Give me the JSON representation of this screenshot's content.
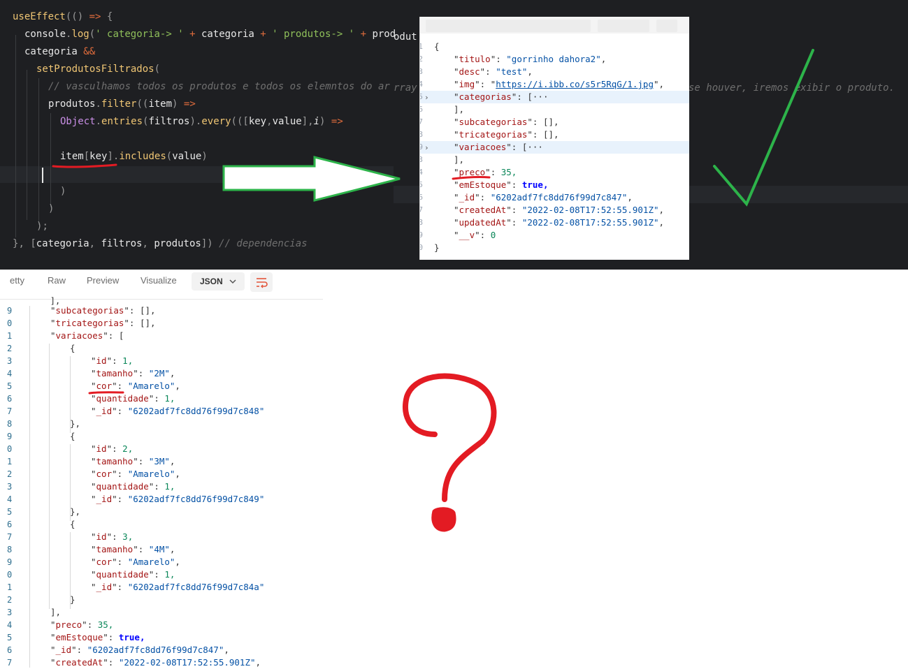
{
  "editor": {
    "lines": [
      {
        "id": "l1",
        "text": "useEffect(() => {"
      },
      {
        "id": "l2",
        "text": "console.log(' categoria-> ' + categoria + ' produtos-> ' + prod"
      },
      {
        "id": "l3",
        "text": "categoria &&"
      },
      {
        "id": "l4",
        "text": "setProdutosFiltrados("
      },
      {
        "id": "l5",
        "text": "// vasculhamos todos os produtos e todos os elemntos do ar"
      },
      {
        "id": "l6",
        "text": "produtos.filter((item) =>"
      },
      {
        "id": "l7",
        "text": "Object.entries(filtros).every(([key,value],i) =>"
      },
      {
        "id": "l8",
        "text": "item[key].includes(value)"
      },
      {
        "id": "l9",
        "text": ")"
      },
      {
        "id": "l10",
        "text": ")"
      },
      {
        "id": "l11",
        "text": ");"
      },
      {
        "id": "l12",
        "text": "}, [categoria, filtros, produtos]) // dependencias"
      }
    ],
    "overflow_comment_left": "rray",
    "overflow_comment_right": "se houver, iremos exibir o produto.",
    "overflow_top": "odut"
  },
  "popup_json": {
    "lines": [
      {
        "n": "1",
        "text": "{"
      },
      {
        "n": "2",
        "key": "titulo",
        "val": "gorrinho dahora2",
        "kind": "str"
      },
      {
        "n": "3",
        "key": "desc",
        "val": "test",
        "kind": "str"
      },
      {
        "n": "4",
        "key": "img",
        "val": "https://i.ibb.co/s5r5RqG/1.jpg",
        "kind": "link"
      },
      {
        "n": "5",
        "key": "categorias",
        "val": "[···",
        "kind": "collapsed"
      },
      {
        "n": "6",
        "text": "],"
      },
      {
        "n": "7",
        "key": "subcategorias",
        "val": "[],",
        "kind": "raw"
      },
      {
        "n": "8",
        "key": "tricategorias",
        "val": "[],",
        "kind": "raw"
      },
      {
        "n": "9",
        "key": "variacoes",
        "val": "[···",
        "kind": "collapsed"
      },
      {
        "n": "3",
        "text": "],"
      },
      {
        "n": "4",
        "key": "preco",
        "val": "35,",
        "kind": "num"
      },
      {
        "n": "5",
        "key": "emEstoque",
        "val": "true,",
        "kind": "bool"
      },
      {
        "n": "6",
        "key": "_id",
        "val": "6202adf7fc8dd76f99d7c847",
        "kind": "str"
      },
      {
        "n": "7",
        "key": "createdAt",
        "val": "2022-02-08T17:52:55.901Z",
        "kind": "str"
      },
      {
        "n": "8",
        "key": "updatedAt",
        "val": "2022-02-08T17:52:55.901Z",
        "kind": "str"
      },
      {
        "n": "9",
        "key": "__v",
        "val": "0",
        "kind": "numlast"
      },
      {
        "n": "0",
        "text": "}"
      }
    ]
  },
  "bottom_panel": {
    "tabs": [
      "etty",
      "Raw",
      "Preview",
      "Visualize"
    ],
    "format_select": "JSON",
    "json_lines": [
      {
        "n": "9",
        "indent": 1,
        "key": "subcategorias",
        "val": "[],",
        "kind": "raw"
      },
      {
        "n": "0",
        "indent": 1,
        "key": "tricategorias",
        "val": "[],",
        "kind": "raw"
      },
      {
        "n": "1",
        "indent": 1,
        "key": "variacoes",
        "val": "[",
        "kind": "raw"
      },
      {
        "n": "2",
        "indent": 2,
        "text": "{"
      },
      {
        "n": "3",
        "indent": 3,
        "key": "id",
        "val": "1,",
        "kind": "num"
      },
      {
        "n": "4",
        "indent": 3,
        "key": "tamanho",
        "val": "2M",
        "kind": "str"
      },
      {
        "n": "5",
        "indent": 3,
        "key": "cor",
        "val": "Amarelo",
        "kind": "str"
      },
      {
        "n": "6",
        "indent": 3,
        "key": "quantidade",
        "val": "1,",
        "kind": "num"
      },
      {
        "n": "7",
        "indent": 3,
        "key": "_id",
        "val": "6202adf7fc8dd76f99d7c848",
        "kind": "strlast"
      },
      {
        "n": "8",
        "indent": 2,
        "text": "},"
      },
      {
        "n": "9",
        "indent": 2,
        "text": "{"
      },
      {
        "n": "0",
        "indent": 3,
        "key": "id",
        "val": "2,",
        "kind": "num"
      },
      {
        "n": "1",
        "indent": 3,
        "key": "tamanho",
        "val": "3M",
        "kind": "str"
      },
      {
        "n": "2",
        "indent": 3,
        "key": "cor",
        "val": "Amarelo",
        "kind": "str"
      },
      {
        "n": "3",
        "indent": 3,
        "key": "quantidade",
        "val": "1,",
        "kind": "num"
      },
      {
        "n": "4",
        "indent": 3,
        "key": "_id",
        "val": "6202adf7fc8dd76f99d7c849",
        "kind": "strlast"
      },
      {
        "n": "5",
        "indent": 2,
        "text": "},"
      },
      {
        "n": "6",
        "indent": 2,
        "text": "{"
      },
      {
        "n": "7",
        "indent": 3,
        "key": "id",
        "val": "3,",
        "kind": "num"
      },
      {
        "n": "8",
        "indent": 3,
        "key": "tamanho",
        "val": "4M",
        "kind": "str"
      },
      {
        "n": "9",
        "indent": 3,
        "key": "cor",
        "val": "Amarelo",
        "kind": "str"
      },
      {
        "n": "0",
        "indent": 3,
        "key": "quantidade",
        "val": "1,",
        "kind": "num"
      },
      {
        "n": "1",
        "indent": 3,
        "key": "_id",
        "val": "6202adf7fc8dd76f99d7c84a",
        "kind": "strlast"
      },
      {
        "n": "2",
        "indent": 2,
        "text": "}"
      },
      {
        "n": "3",
        "indent": 1,
        "text": "],"
      },
      {
        "n": "4",
        "indent": 1,
        "key": "preco",
        "val": "35,",
        "kind": "num"
      },
      {
        "n": "5",
        "indent": 1,
        "key": "emEstoque",
        "val": "true,",
        "kind": "bool"
      },
      {
        "n": "6",
        "indent": 1,
        "key": "_id",
        "val": "6202adf7fc8dd76f99d7c847",
        "kind": "str"
      },
      {
        "n": "7",
        "indent": 1,
        "key": "createdAt",
        "val": "2022-02-08T17:52:55.901Z",
        "kind": "str"
      }
    ]
  },
  "annotations": {
    "arrow_color": "#2db34a",
    "check_color": "#2db34a",
    "question_color": "#e31b23",
    "underline_color": "#e31b23"
  }
}
